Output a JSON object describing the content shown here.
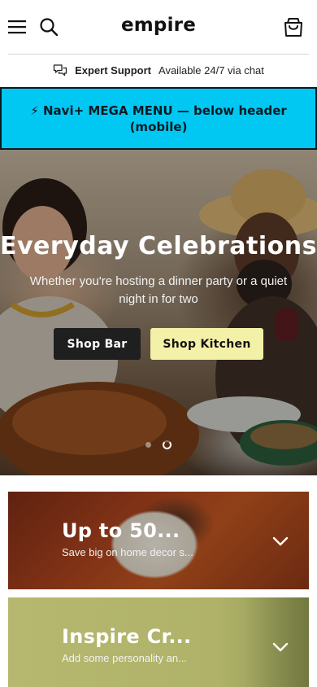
{
  "header": {
    "logo": "empire",
    "menu_icon": "hamburger-icon",
    "search_icon": "search-icon",
    "cart_icon": "shopping-bag-icon"
  },
  "support": {
    "icon": "chat-bubbles-icon",
    "title": "Expert Support",
    "text": "Available 24/7 via chat"
  },
  "mega_menu": {
    "label": "⚡ Navi+ MEGA MENU — below header (mobile)",
    "background": "#00c8f2"
  },
  "hero": {
    "title": "Everyday Celebrations",
    "subtitle": "Whether you're hosting a dinner party or a quiet night in for two",
    "buttons": [
      {
        "label": "Shop Bar"
      },
      {
        "label": "Shop Kitchen"
      }
    ],
    "slides": {
      "count": 2,
      "active_index": 1
    }
  },
  "cards": [
    {
      "title": "Up to 50...",
      "description": "Save big on home decor s...",
      "icon": "chevron-down-icon"
    },
    {
      "title": "Inspire Cr...",
      "description": "Add some personality an...",
      "icon": "chevron-down-icon"
    }
  ],
  "colors": {
    "accent_yellow": "#f3f0a8",
    "dark_button": "#1f1f1f",
    "card_green": "#b6b870"
  }
}
